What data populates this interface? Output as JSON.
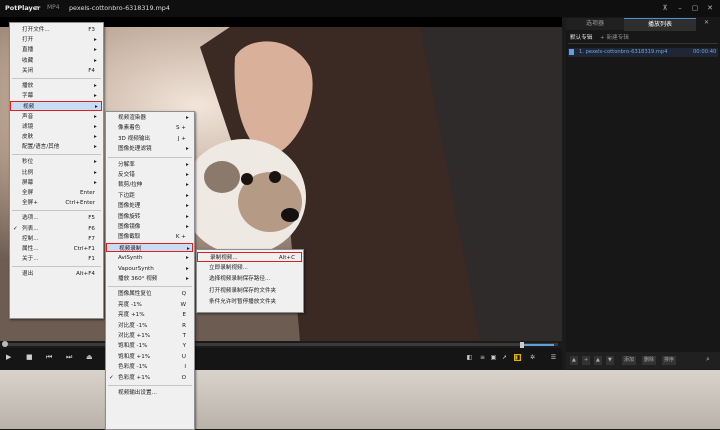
{
  "app": {
    "name": "PotPlayer",
    "format": "MP4",
    "filename": "pexels-cottonbro-6318319.mp4",
    "colors": {
      "accent": "#4a8fd6",
      "highlight_box": "#e02020",
      "playlist_text": "#67a7ea"
    }
  },
  "window_buttons": [
    "pin-icon",
    "minimize-icon",
    "restore-icon",
    "close-icon"
  ],
  "playlist_panel": {
    "tabs": [
      "选项器",
      "播放列表"
    ],
    "subtabs": [
      "默认专辑",
      "+ 新建专辑"
    ],
    "item": {
      "name": "1. pexels-cottonbro-6318319.mp4",
      "time": "00:00:40"
    },
    "bottom_buttons": [
      "添加",
      "删除",
      "排序"
    ]
  },
  "main_menu": [
    {
      "label": "打开文件...",
      "shortcut": "F3"
    },
    {
      "label": "打开",
      "arrow": true
    },
    {
      "label": "直播",
      "arrow": true
    },
    {
      "label": "收藏",
      "arrow": true
    },
    {
      "label": "关闭",
      "shortcut": "F4"
    },
    {
      "sep": true
    },
    {
      "label": "播放",
      "arrow": true
    },
    {
      "label": "字幕",
      "arrow": true
    },
    {
      "label": "视频",
      "arrow": true,
      "highlight": true,
      "boxed": true
    },
    {
      "label": "声音",
      "arrow": true
    },
    {
      "label": "滤镜",
      "arrow": true
    },
    {
      "label": "皮肤",
      "arrow": true
    },
    {
      "label": "配置/语言/其他",
      "arrow": true
    },
    {
      "sep": true
    },
    {
      "label": "秒位",
      "arrow": true
    },
    {
      "label": "比例",
      "arrow": true
    },
    {
      "label": "屏幕",
      "arrow": true
    },
    {
      "label": "全屏",
      "shortcut": "Enter"
    },
    {
      "label": "全屏+",
      "shortcut": "Ctrl+Enter"
    },
    {
      "sep": true
    },
    {
      "label": "选项...",
      "shortcut": "F5"
    },
    {
      "label": "列表...",
      "shortcut": "F6",
      "check": true
    },
    {
      "label": "控制...",
      "shortcut": "F7"
    },
    {
      "label": "属性...",
      "shortcut": "Ctrl+F1"
    },
    {
      "label": "关于...",
      "shortcut": "F1"
    },
    {
      "sep": true
    },
    {
      "label": "退出",
      "shortcut": "Alt+F4"
    }
  ],
  "video_menu": [
    {
      "label": "视频渲染器",
      "arrow": true
    },
    {
      "label": "像素着色",
      "shortcut": "S +"
    },
    {
      "label": "3D 视频输出",
      "shortcut": "J +"
    },
    {
      "label": "图像处理滤镜",
      "arrow": true
    },
    {
      "sep": true
    },
    {
      "label": "分解率",
      "arrow": true
    },
    {
      "label": "反交错",
      "arrow": true
    },
    {
      "label": "裁剪/拉伸",
      "arrow": true
    },
    {
      "label": "下边距",
      "arrow": true
    },
    {
      "label": "图像处理",
      "arrow": true
    },
    {
      "label": "图像旋转",
      "arrow": true
    },
    {
      "label": "图像镜像",
      "arrow": true
    },
    {
      "label": "图像截取",
      "shortcut": "K +"
    },
    {
      "label": "视频录制",
      "arrow": true,
      "highlight": true,
      "boxed": true
    },
    {
      "label": "AviSynth",
      "arrow": true
    },
    {
      "label": "VapourSynth",
      "arrow": true
    },
    {
      "label": "播放 360° 视频",
      "arrow": true
    },
    {
      "sep": true
    },
    {
      "label": "图像属性复位",
      "shortcut": "Q"
    },
    {
      "label": "亮度 -1%",
      "shortcut": "W"
    },
    {
      "label": "亮度 +1%",
      "shortcut": "E"
    },
    {
      "label": "对比度 -1%",
      "shortcut": "R"
    },
    {
      "label": "对比度 +1%",
      "shortcut": "T"
    },
    {
      "label": "饱和度 -1%",
      "shortcut": "Y"
    },
    {
      "label": "饱和度 +1%",
      "shortcut": "U"
    },
    {
      "label": "色彩度 -1%",
      "shortcut": "I"
    },
    {
      "label": "色彩度 +1%",
      "shortcut": "O",
      "check": true
    },
    {
      "sep": true
    },
    {
      "label": "视频输出设置..."
    }
  ],
  "record_menu": [
    {
      "label": "录制视频...",
      "shortcut": "Alt+C",
      "boxed": true
    },
    {
      "label": "立即录制视频..."
    },
    {
      "label": "选择视频录制保存路径..."
    },
    {
      "label": "打开视频录制保存的文件夹"
    },
    {
      "label": "条件允许时暂停播放文件夹"
    }
  ]
}
